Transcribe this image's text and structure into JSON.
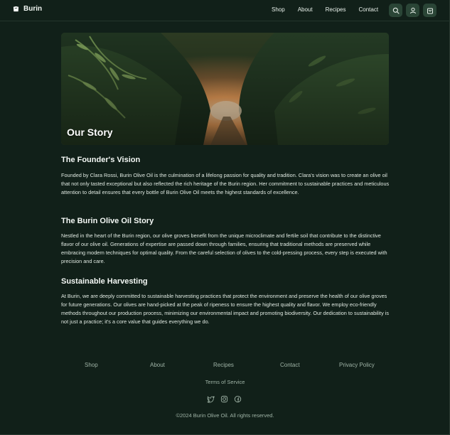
{
  "header": {
    "brand": "Burin",
    "nav": [
      "Shop",
      "About",
      "Recipes",
      "Contact"
    ],
    "icons": [
      "search-icon",
      "user-icon",
      "cart-icon"
    ]
  },
  "hero": {
    "title": "Our Story"
  },
  "sections": [
    {
      "title": "The Founder's Vision",
      "text": "Founded by Clara Rossi, Burin Olive Oil is the culmination of a lifelong passion for quality and tradition. Clara's vision was to create an olive oil that not only tasted exceptional but also reflected the rich heritage of the Burin region. Her commitment to sustainable practices and meticulous attention to detail ensures that every bottle of Burin Olive Oil meets the highest standards of excellence."
    },
    {
      "title": "The Burin Olive Oil Story",
      "text": "Nestled in the heart of the Burin region, our olive groves benefit from the unique microclimate and fertile soil that contribute to the distinctive flavor of our olive oil. Generations of expertise are passed down through families, ensuring that traditional methods are preserved while embracing modern techniques for optimal quality. From the careful selection of olives to the cold-pressing process, every step is executed with precision and care."
    },
    {
      "title": "Sustainable Harvesting",
      "text": "At Burin, we are deeply committed to sustainable harvesting practices that protect the environment and preserve the health of our olive groves for future generations. Our olives are hand-picked at the peak of ripeness to ensure the highest quality and flavor. We employ eco-friendly methods throughout our production process, minimizing our environmental impact and promoting biodiversity. Our dedication to sustainability is not just a practice; it's a core value that guides everything we do."
    }
  ],
  "footer": {
    "links": [
      "Shop",
      "About",
      "Recipes",
      "Contact",
      "Privacy Policy"
    ],
    "terms": "Terms of Service",
    "social": [
      "twitter-icon",
      "instagram-icon",
      "facebook-icon"
    ],
    "copyright": "©2024 Burin Olive Oil. All rights reserved."
  },
  "colors": {
    "background": "#112019",
    "icon_button": "#2a4536",
    "muted_text": "#9fb3a6"
  }
}
